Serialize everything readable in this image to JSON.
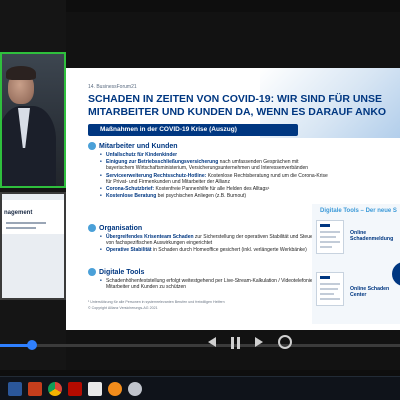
{
  "video": {
    "speaker_tile_label": "",
    "slide_tile_label": "nagement"
  },
  "slide": {
    "number": "14. BusinessForum21",
    "title_line1": "SCHADEN IN ZEITEN VON COVID-19: WIR SIND FÜR UNSE",
    "title_line2": "MITARBEITER UND KUNDEN DA, WENN ES DARAUF ANKO",
    "measures_tab": "Maßnahmen in der COVID-19 Krise (Auszug)",
    "sections": [
      {
        "title": "Mitarbeiter und Kunden",
        "bullets": [
          {
            "hl": "Unfallschutz für Kindenkinder",
            "rest": ""
          },
          {
            "hl": "Einigung zur Betriebsschließungsversicherung",
            "rest": " nach umfassenden Gesprächen mit bayerischem Wirtschaftsministerium, Versicherungsunternehmen und Interessenverbänden"
          },
          {
            "hl": "Serviceerweiterung Rechtsschutz-Hotline:",
            "rest": " Kostenlose Rechtsberatung rund um die Corona-Krise für Privat- und Firmenkunden und Mitarbeiter der Allianz"
          },
          {
            "hl": "Corona-Schutzbrief:",
            "rest": " Kostenfreie Pannenhilfe für alle Helden des Alltags¹"
          },
          {
            "hl": "Kostenlose Beratung",
            "rest": " bei psychischen Anliegen (z.B. Burnout)"
          }
        ]
      },
      {
        "title": "Organisation",
        "bullets": [
          {
            "hl": "Übergreifendes Krisenteam Schaden",
            "rest": " zur Sicherstellung der operativen Stabilität und Steuerung von fachspezifischen Auswirkungen eingerichtet"
          },
          {
            "hl": "Operative Stabilität",
            "rest": " in Schaden durch Homeoffice gesichert (inkl. verlängerte Werkbänke)"
          }
        ]
      },
      {
        "title": "Digitale Tools",
        "bullets": [
          {
            "hl": "",
            "rest": "Schadenhöhenfeststellung erfolgt weitestgehend per Live-Stream-Kalkulation / Videotelefonie, um Mitarbeiter und Kunden zu schützen"
          }
        ]
      }
    ],
    "footnote1": "¹ Unterstützung für alle Personen in systemrelevanten Berufen und freiwilligen Helfern",
    "footnote2": "© Copyright Allianz Versicherungs-AG 2021",
    "digital_tools_title": "Digitale Tools – Der neue S",
    "tool1_label": "Online Schadenmeldung",
    "tool2_label": "Online Schaden Center"
  },
  "player": {
    "progress_fraction": 0.08
  },
  "colors": {
    "allianz_blue": "#003781",
    "accent_light_blue": "#3c9ad8",
    "speaker_border": "#2fbf3d",
    "progress": "#2f80ff"
  },
  "taskbar": {
    "apps": [
      "word-icon",
      "powerpoint-icon",
      "chrome-icon",
      "acrobat-icon",
      "chat-icon",
      "media-icon",
      "browser-icon"
    ]
  }
}
